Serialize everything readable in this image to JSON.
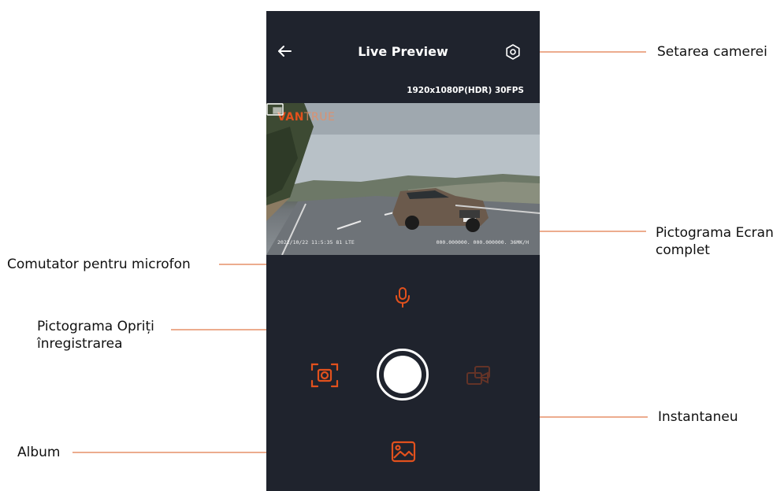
{
  "app": {
    "title": "Live Preview",
    "resolution": "1920x1080P(HDR) 30FPS",
    "brand_part1": "VAN",
    "brand_part2": "TRUE",
    "overlay_datetime": "2022/10/22  11:5:35   81 LTE",
    "overlay_gps": "000.000000.  000.000000.  36MK/H"
  },
  "annotations": {
    "camera_settings": "Setarea camerei",
    "fullscreen_line1": "Pictograma Ecran",
    "fullscreen_line2": "complet",
    "mic_toggle": "Comutator pentru microfon",
    "stop_recording_line1": "Pictograma Opriți",
    "stop_recording_line2": "înregistrarea",
    "snapshot": "Instantaneu",
    "album": "Album"
  },
  "icons": {
    "back": "arrow-left-icon",
    "settings": "gear-icon",
    "fullscreen": "fullscreen-icon",
    "microphone": "microphone-icon",
    "record": "stop-record-button",
    "snapshot": "camera-snapshot-icon",
    "switch_camera": "switch-camera-icon",
    "album": "image-album-icon"
  },
  "colors": {
    "panel_bg": "#1f232d",
    "accent": "#e2511d",
    "leader": "#e07a4a"
  }
}
